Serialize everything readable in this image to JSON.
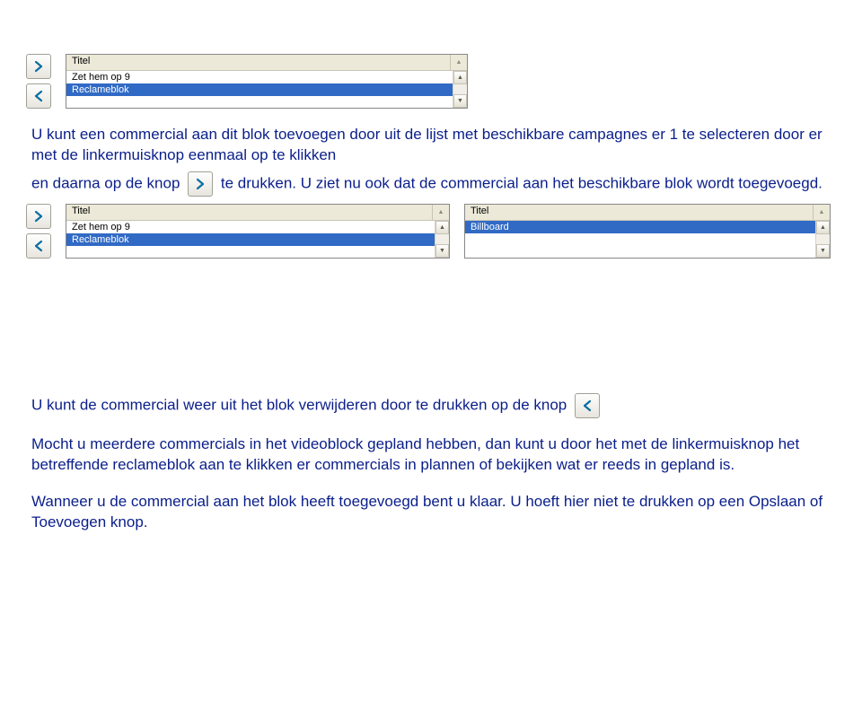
{
  "list1": {
    "header": "Titel",
    "rows": [
      "Zet hem op 9",
      "Reclameblok"
    ],
    "selected_index": 1
  },
  "para1_a": "U kunt een commercial aan dit blok toevoegen door uit de lijst met beschikbare campagnes er 1 te selecteren door er met de linkermuisknop eenmaal op te klikken",
  "para1_b_pre": "en daarna op de knop",
  "para1_b_post": "te drukken. U ziet nu ook dat de commercial aan het beschikbare blok wordt toegevoegd.",
  "list2a": {
    "header": "Titel",
    "rows": [
      "Zet hem op 9",
      "Reclameblok"
    ],
    "selected_index": 1
  },
  "list2b": {
    "header": "Titel",
    "rows": [
      "Billboard"
    ],
    "selected_index": 0
  },
  "para2_pre": "U kunt de commercial weer uit het blok verwijderen door te drukken op de knop",
  "para3": "Mocht u meerdere commercials in het videoblock gepland hebben, dan kunt u door het met de linkermuisknop het betreffende reclameblok aan te klikken er commercials in plannen of bekijken wat er reeds in gepland is.",
  "para4": "Wanneer u de commercial aan het blok heeft toegevoegd bent u klaar. U hoeft hier niet te drukken op een Opslaan of Toevoegen knop."
}
